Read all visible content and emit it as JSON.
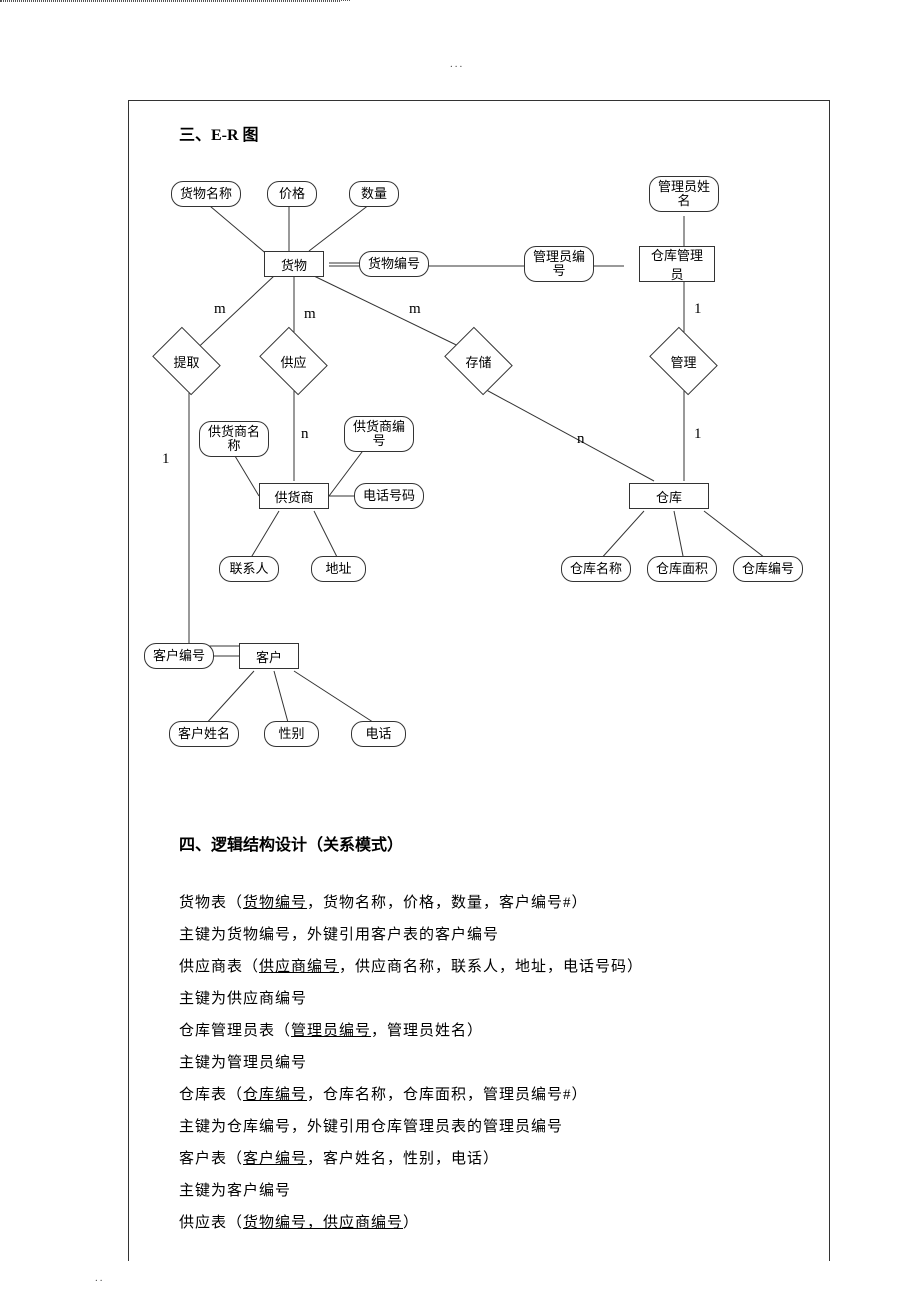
{
  "header": {
    "center_mark": "..."
  },
  "footer": {
    "mark": ".."
  },
  "section3": {
    "title": "三、E-R 图",
    "entities": {
      "goods": "货物",
      "supplier": "供货商",
      "customer": "客户",
      "warehouse": "仓库",
      "manager": "仓库管理\n员"
    },
    "attributes": {
      "goods_name": "货物名称",
      "price": "价格",
      "quantity": "数量",
      "goods_id": "货物编号",
      "manager_name": "管理员姓\n名",
      "manager_id": "管理员编\n号",
      "supplier_name": "供货商名\n称",
      "supplier_id": "供货商编\n号",
      "phone": "电话号码",
      "contact": "联系人",
      "address": "地址",
      "wh_name": "仓库名称",
      "wh_area": "仓库面积",
      "wh_id": "仓库编号",
      "cust_id": "客户编号",
      "cust_name": "客户姓名",
      "gender": "性别",
      "tel": "电话"
    },
    "relations": {
      "extract": "提取",
      "supply": "供应",
      "store": "存储",
      "manage": "管理"
    },
    "cardinality": {
      "m": "m",
      "n": "n",
      "one": "1"
    }
  },
  "section4": {
    "title": "四、逻辑结构设计（关系模式）",
    "lines": [
      {
        "pre": "货物表（",
        "u": "货物编号",
        "post": "，货物名称，价格，数量，客户编号#）"
      },
      {
        "pre": "主键为货物编号，外键引用客户表的客户编号",
        "u": "",
        "post": ""
      },
      {
        "pre": "供应商表（",
        "u": "供应商编号",
        "post": "，供应商名称，联系人，地址，电话号码）"
      },
      {
        "pre": "主键为供应商编号",
        "u": "",
        "post": ""
      },
      {
        "pre": "仓库管理员表（",
        "u": "管理员编号",
        "post": "，管理员姓名）"
      },
      {
        "pre": "主键为管理员编号",
        "u": "",
        "post": ""
      },
      {
        "pre": "仓库表（",
        "u": "仓库编号",
        "post": "，仓库名称，仓库面积，管理员编号#）"
      },
      {
        "pre": "主键为仓库编号，外键引用仓库管理员表的管理员编号",
        "u": "",
        "post": ""
      },
      {
        "pre": "客户表（",
        "u": "客户编号",
        "post": "，客户姓名，性别，电话）"
      },
      {
        "pre": "主键为客户编号",
        "u": "",
        "post": ""
      },
      {
        "pre": "供应表（",
        "u": "货物编号，供应商编号",
        "post": "）"
      }
    ]
  }
}
